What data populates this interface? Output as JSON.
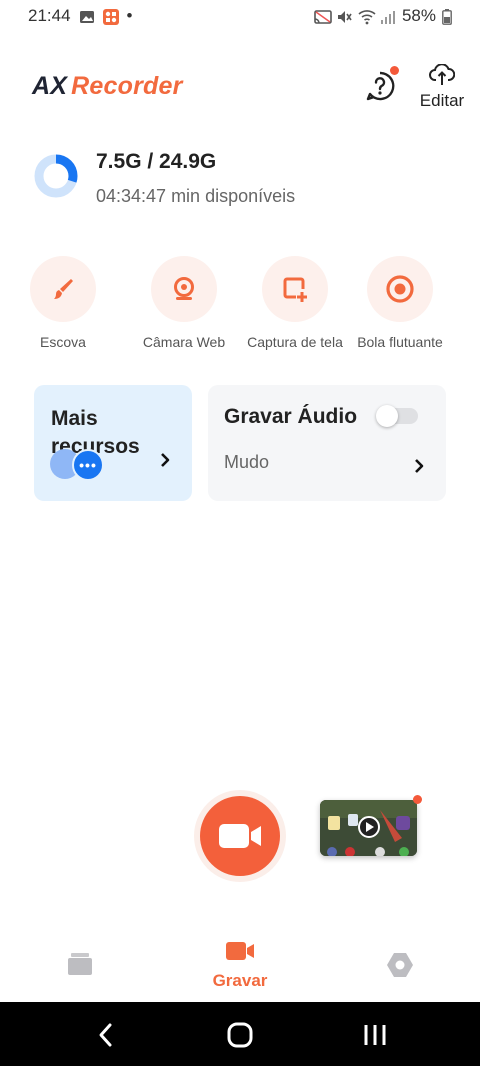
{
  "status_bar": {
    "time": "21:44",
    "dot": "•",
    "battery": "58%"
  },
  "header": {
    "logo_ax": "AX",
    "logo_recorder": "Recorder",
    "edit_label": "Editar"
  },
  "storage": {
    "used": "7.5G / 24.9G",
    "available": "04:34:47 min disponíveis",
    "used_fraction": 0.3
  },
  "tools": [
    {
      "label": "Escova",
      "icon": "brush-icon"
    },
    {
      "label": "Câmara Web",
      "icon": "webcam-icon"
    },
    {
      "label": "Captura de tela",
      "icon": "screenshot-icon"
    },
    {
      "label": "Bola flutuante",
      "icon": "floating-ball-icon"
    }
  ],
  "cards": {
    "more_title": "Mais recursos",
    "more_dots": "•••",
    "audio_title": "Gravar Áudio",
    "audio_mode": "Mudo"
  },
  "bottom_nav": {
    "record_label": "Gravar"
  },
  "colors": {
    "accent": "#f26a3e",
    "blue": "#1976f2",
    "light_blue": "#e3f1fd"
  }
}
